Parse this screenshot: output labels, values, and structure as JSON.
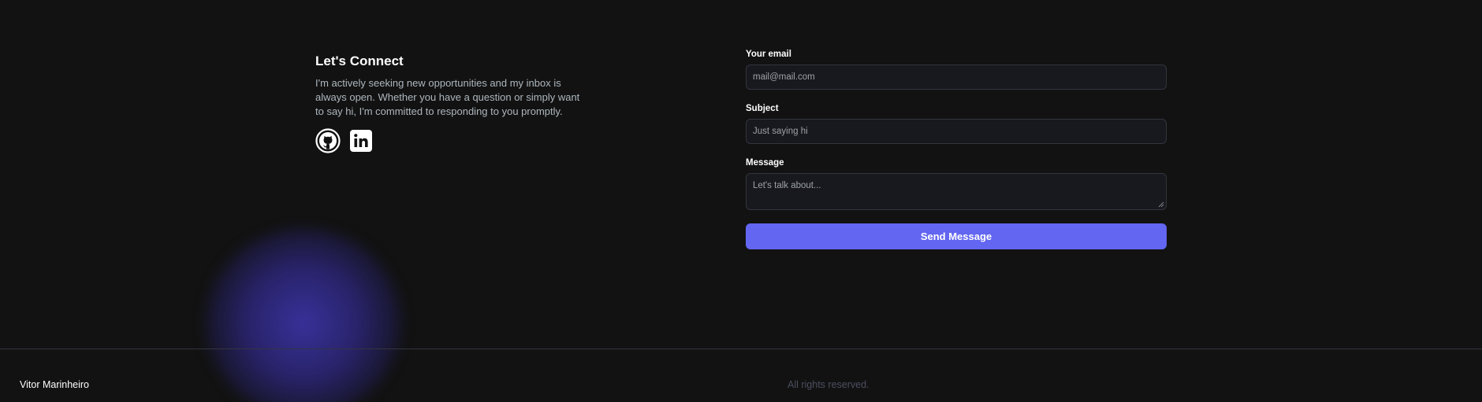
{
  "connect": {
    "title": "Let's Connect",
    "description": "I'm actively seeking new opportunities and my inbox is always open. Whether you have a question or simply want to say hi, I'm committed to responding to you promptly.",
    "socials": [
      {
        "name": "github",
        "icon": "github-icon"
      },
      {
        "name": "linkedin",
        "icon": "linkedin-icon"
      }
    ]
  },
  "form": {
    "email_label": "Your email",
    "email_placeholder": "mail@mail.com",
    "subject_label": "Subject",
    "subject_placeholder": "Just saying hi",
    "message_label": "Message",
    "message_placeholder": "Let's talk about...",
    "submit_label": "Send Message"
  },
  "footer": {
    "name": "Vitor Marinheiro",
    "rights": "All rights reserved."
  },
  "colors": {
    "background": "#121212",
    "accent": "#6366f1",
    "input_background": "#18191e",
    "input_border": "#33353f",
    "muted_text": "#adb7be"
  }
}
